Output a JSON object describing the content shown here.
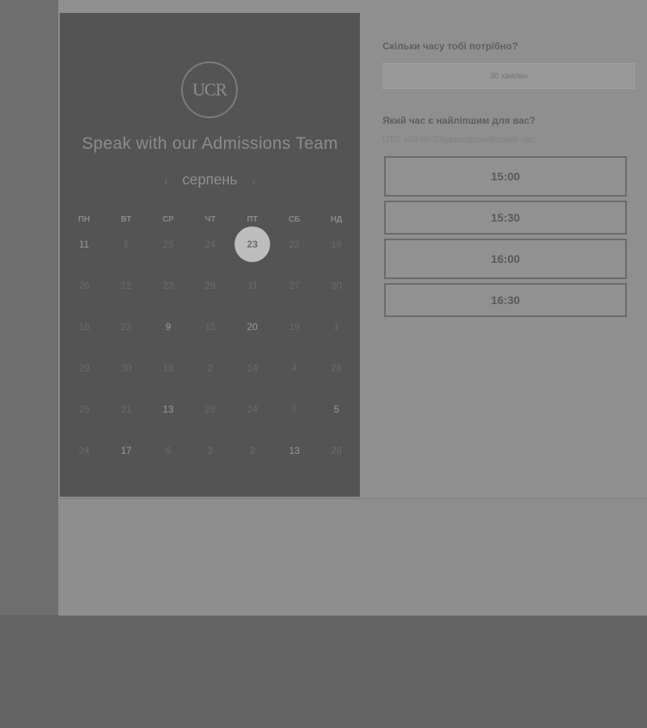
{
  "calendar": {
    "title": "Speak with our Admissions Team",
    "logo_text": "UCR",
    "month": "серпень",
    "prev_icon": "chevron-left-icon",
    "next_icon": "chevron-right-icon",
    "weekdays": [
      "ПН",
      "ВТ",
      "СР",
      "ЧТ",
      "ПТ",
      "СБ",
      "НД"
    ],
    "weeks": [
      [
        "11",
        "5",
        "25",
        "24",
        "23",
        "22",
        "16"
      ],
      [
        "26",
        "12",
        "23",
        "29",
        "31",
        "27",
        "30"
      ],
      [
        "16",
        "22",
        "9",
        "15",
        "20",
        "19",
        "1"
      ],
      [
        "29",
        "30",
        "18",
        "2",
        "14",
        "4",
        "26"
      ],
      [
        "25",
        "21",
        "13",
        "28",
        "24",
        "7",
        "5"
      ],
      [
        "24",
        "17",
        "6",
        "3",
        "2",
        "13",
        "28"
      ]
    ],
    "selected_day": "23",
    "available": [
      "23",
      "31",
      "20",
      "21",
      "18",
      "17",
      "9",
      "6",
      "5",
      "11",
      "13",
      "14"
    ]
  },
  "booking": {
    "duration_question": "Скільки часу тобі потрібно?",
    "duration_value": "30 хвилин",
    "time_question": "Який час є найліпшим для вас?",
    "timezone": "UTC +03:00 Східноєвропейський час",
    "slots": [
      "15:00",
      "15:30",
      "16:00",
      "16:30"
    ]
  }
}
